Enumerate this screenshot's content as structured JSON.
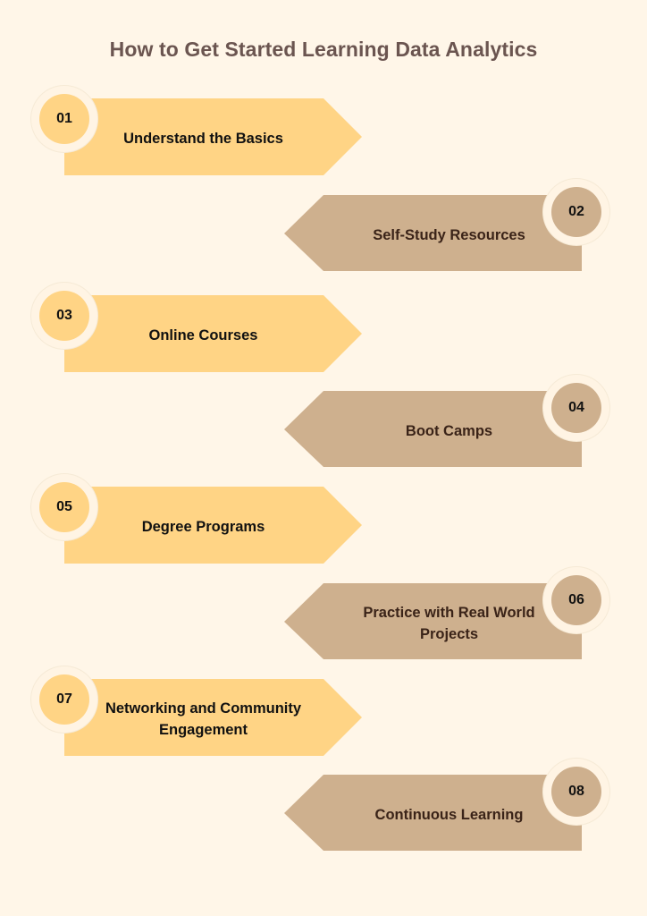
{
  "title": "How to Get Started Learning Data Analytics",
  "colors": {
    "background": "#FFF6E8",
    "title": "#6B5550",
    "odd_step_fill": "#FFD485",
    "even_step_fill": "#CEB08E",
    "badge_ring": "#FFF4E4"
  },
  "steps": [
    {
      "number": "01",
      "label": "Understand the Basics",
      "direction": "right-pointing"
    },
    {
      "number": "02",
      "label": "Self-Study Resources",
      "direction": "left-pointing"
    },
    {
      "number": "03",
      "label": "Online Courses",
      "direction": "right-pointing"
    },
    {
      "number": "04",
      "label": "Boot Camps",
      "direction": "left-pointing"
    },
    {
      "number": "05",
      "label": "Degree Programs",
      "direction": "right-pointing"
    },
    {
      "number": "06",
      "label": "Practice with Real World Projects",
      "direction": "left-pointing"
    },
    {
      "number": "07",
      "label": "Networking and Community Engagement",
      "direction": "right-pointing"
    },
    {
      "number": "08",
      "label": "Continuous Learning",
      "direction": "left-pointing"
    }
  ]
}
